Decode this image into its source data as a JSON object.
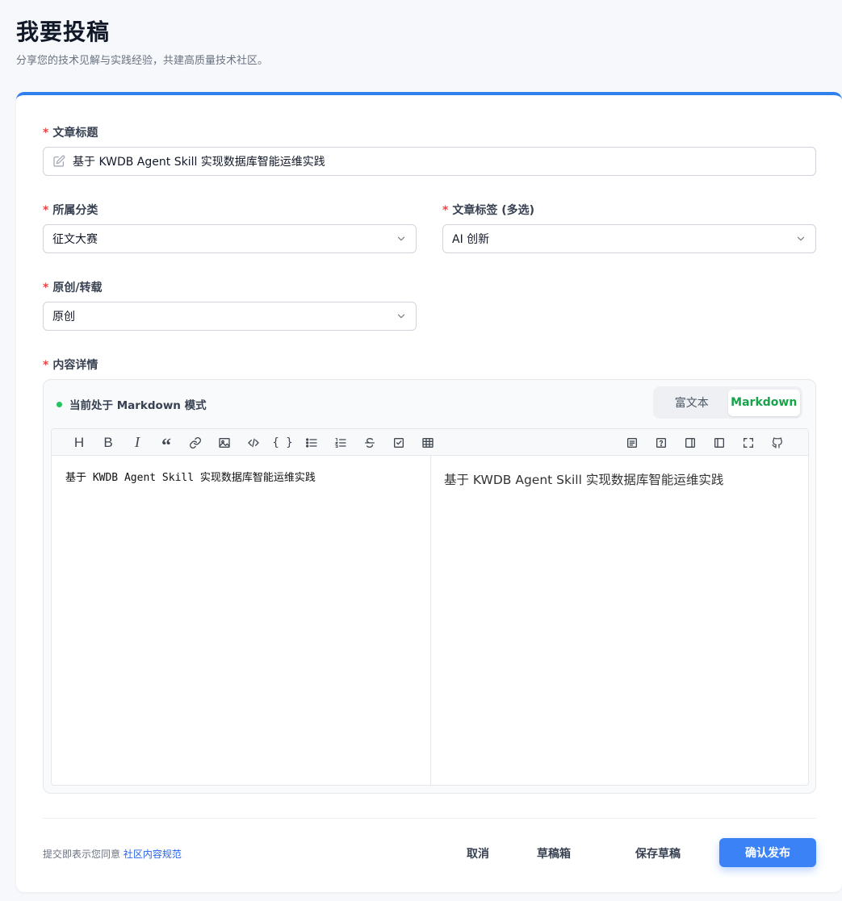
{
  "header": {
    "title": "我要投稿",
    "subtitle": "分享您的技术见解与实践经验，共建高质量技术社区。"
  },
  "form": {
    "required_mark": "*",
    "title_label": "文章标题",
    "title_value": "基于 KWDB Agent Skill 实现数据库智能运维实践",
    "category_label": "所属分类",
    "category_value": "征文大赛",
    "tags_label": "文章标签 (多选)",
    "tags_value": "AI 创新",
    "origin_label": "原创/转载",
    "origin_value": "原创",
    "content_label": "内容详情"
  },
  "editor": {
    "mode_status": "当前处于 Markdown 模式",
    "mode_rich": "富文本",
    "mode_markdown": "Markdown",
    "source_text": "基于 KWDB Agent Skill 实现数据库智能运维实践",
    "preview_text": "基于 KWDB Agent Skill 实现数据库智能运维实践",
    "toolbar_glyphs": {
      "heading": "H",
      "bold": "B",
      "italic": "I",
      "quote": "“",
      "code_block": "{ }"
    }
  },
  "footer": {
    "agree_prefix": "提交即表示您同意 ",
    "agree_link": "社区内容规范",
    "cancel": "取消",
    "drafts": "草稿箱",
    "save_draft": "保存草稿",
    "publish": "确认发布"
  },
  "colors": {
    "accent": "#2f80ed",
    "primary_button": "#3b82f6",
    "required": "#ef4444",
    "markdown_active": "#16a34a",
    "status_dot": "#22c55e"
  }
}
